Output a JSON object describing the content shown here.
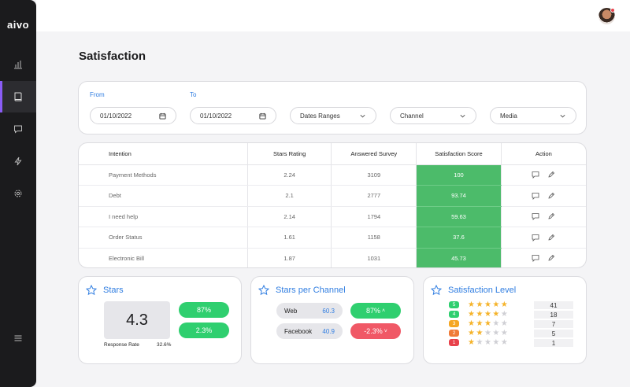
{
  "app": {
    "logo": "aivo"
  },
  "page": {
    "title": "Satisfaction"
  },
  "filters": {
    "from_label": "From",
    "to_label": "To",
    "from_value": "01/10/2022",
    "to_value": "01/10/2022",
    "dates_ranges": "Dates Ranges",
    "channel": "Channel",
    "media": "Media"
  },
  "table": {
    "headers": [
      "Intention",
      "Stars Rating",
      "Answered Survey",
      "Satisfaction Score",
      "Action"
    ],
    "rows": [
      [
        "Payment Methods",
        "2.24",
        "3109",
        "100"
      ],
      [
        "Debt",
        "2.1",
        "2777",
        "93.74"
      ],
      [
        "I need help",
        "2.14",
        "1794",
        "59.63"
      ],
      [
        "Order Status",
        "1.61",
        "1158",
        "37.6"
      ],
      [
        "Electronic Bill",
        "1.87",
        "1031",
        "45.73"
      ]
    ]
  },
  "stars": {
    "title": "Stars",
    "value": "4.3",
    "response_rate_label": "Response Rate",
    "response_rate_value": "32.6%",
    "pill_top": "87%",
    "pill_bottom": "2.3%"
  },
  "channels": {
    "title": "Stars per Channel",
    "rows": [
      {
        "name": "Web",
        "value": "60.3",
        "delta": "87%",
        "trend": "up"
      },
      {
        "name": "Facebook",
        "value": "40.9",
        "delta": "-2.3%",
        "trend": "down"
      }
    ]
  },
  "levels": {
    "title": "Satisfaction Level",
    "rows": [
      {
        "level": "5",
        "stars": 5,
        "count": "41",
        "color": "#2fcf6f"
      },
      {
        "level": "4",
        "stars": 4,
        "count": "18",
        "color": "#2fcf6f"
      },
      {
        "level": "3",
        "stars": 3,
        "count": "7",
        "color": "#f5a623"
      },
      {
        "level": "2",
        "stars": 2,
        "count": "5",
        "color": "#f07b38"
      },
      {
        "level": "1",
        "stars": 1,
        "count": "1",
        "color": "#e8424b"
      }
    ]
  },
  "colors": {
    "accent": "#2f7de1",
    "active_nav": "#8a5cf6",
    "score_green": "#4cbb6a",
    "up_green": "#2fcf6f",
    "down_red": "#f05866",
    "star": "#f5b32a"
  },
  "icons": [
    "chart-icon",
    "book-icon",
    "chat-icon",
    "bolt-icon",
    "gear-icon",
    "menu-icon",
    "calendar-icon",
    "chevron-down-icon",
    "comment-icon",
    "pencil-icon",
    "star-outline-icon"
  ]
}
